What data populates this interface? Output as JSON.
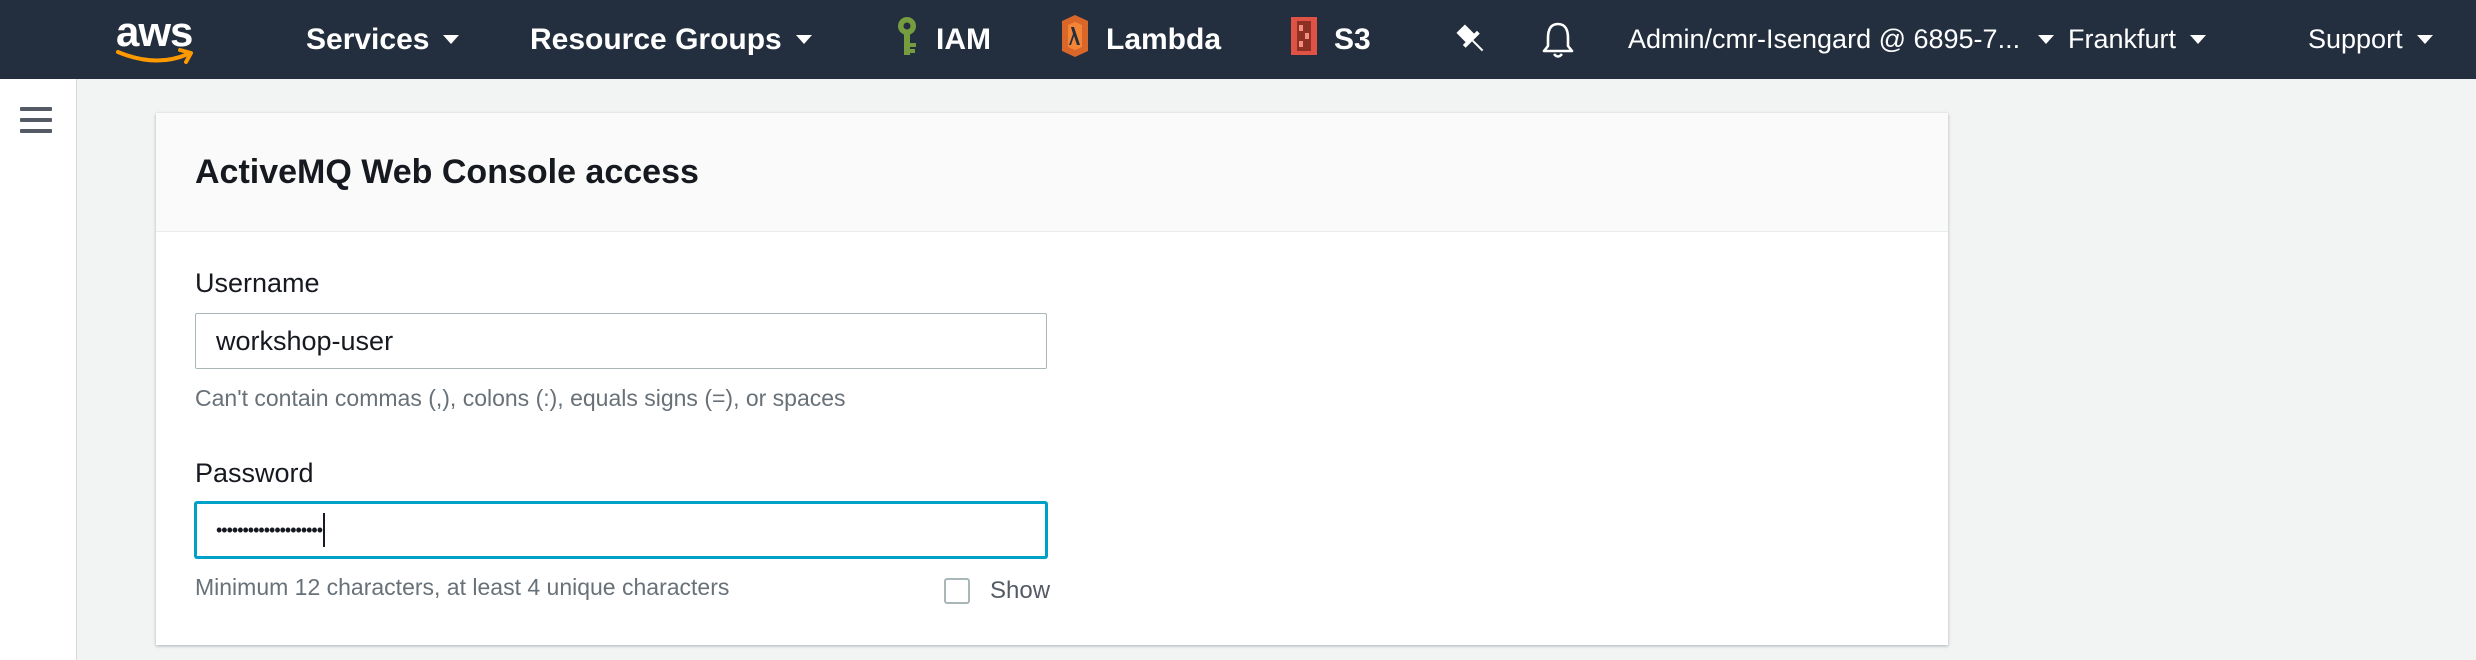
{
  "nav": {
    "brand": "aws",
    "services_label": "Services",
    "resource_groups_label": "Resource Groups",
    "pinned": [
      {
        "label": "IAM",
        "icon": "iam-icon",
        "color": "#759c3e"
      },
      {
        "label": "Lambda",
        "icon": "lambda-icon",
        "color": "#d9672a"
      },
      {
        "label": "S3",
        "icon": "s3-icon",
        "color": "#e05243"
      }
    ],
    "account_label": "Admin/cmr-Isengard @ 6895-7...",
    "region_label": "Frankfurt",
    "support_label": "Support"
  },
  "panel": {
    "title": "ActiveMQ Web Console access",
    "username": {
      "label": "Username",
      "value": "workshop-user",
      "hint": "Can't contain commas (,), colons (:), equals signs (=), or spaces"
    },
    "password": {
      "label": "Password",
      "value": "••••••••••••••••••••",
      "hint": "Minimum 12 characters, at least 4 unique characters",
      "show_label": "Show"
    }
  },
  "colors": {
    "nav_bg": "#232f3e",
    "focus": "#00a1c9",
    "aws_orange": "#ff9900"
  }
}
